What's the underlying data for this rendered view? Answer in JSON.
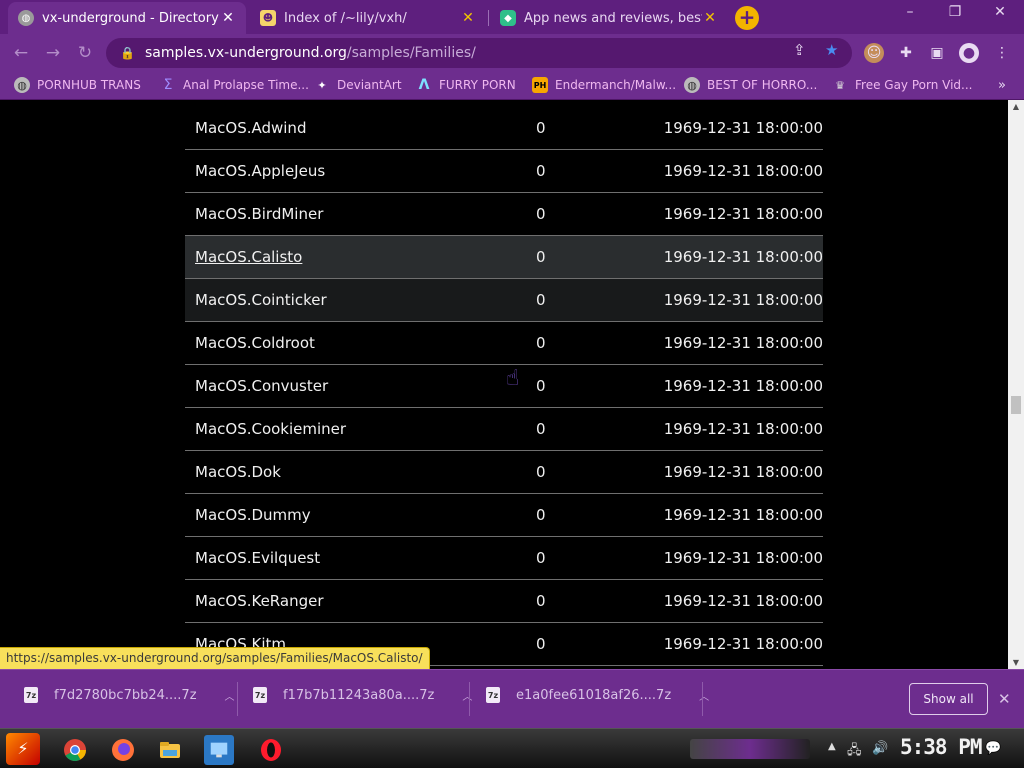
{
  "browser": {
    "tabs": [
      {
        "title": "vx-underground - Directory",
        "active": true
      },
      {
        "title": "Index of /~lily/vxh/",
        "active": false
      },
      {
        "title": "App news and reviews, best sof",
        "active": false
      }
    ],
    "url_host": "samples.vx-underground.org",
    "url_path": "/samples/Families/",
    "bookmarks": [
      {
        "label": "PORNHUB TRANS"
      },
      {
        "label": "Anal Prolapse Time..."
      },
      {
        "label": "DeviantArt"
      },
      {
        "label": "FURRY PORN"
      },
      {
        "label": "Endermanch/Malw..."
      },
      {
        "label": "BEST OF HORRO..."
      },
      {
        "label": "Free Gay Porn Vid..."
      }
    ],
    "bookmarks_more": "»",
    "accent_color": "#6d2d8e",
    "tab_strip_color": "#5e1f7e"
  },
  "listing": {
    "rows": [
      {
        "name": "MacOS.Adwind",
        "size": "0",
        "date": "1969-12-31 18:00:00"
      },
      {
        "name": "MacOS.AppleJeus",
        "size": "0",
        "date": "1969-12-31 18:00:00"
      },
      {
        "name": "MacOS.BirdMiner",
        "size": "0",
        "date": "1969-12-31 18:00:00"
      },
      {
        "name": "MacOS.Calisto",
        "size": "0",
        "date": "1969-12-31 18:00:00"
      },
      {
        "name": "MacOS.Cointicker",
        "size": "0",
        "date": "1969-12-31 18:00:00"
      },
      {
        "name": "MacOS.Coldroot",
        "size": "0",
        "date": "1969-12-31 18:00:00"
      },
      {
        "name": "MacOS.Convuster",
        "size": "0",
        "date": "1969-12-31 18:00:00"
      },
      {
        "name": "MacOS.Cookieminer",
        "size": "0",
        "date": "1969-12-31 18:00:00"
      },
      {
        "name": "MacOS.Dok",
        "size": "0",
        "date": "1969-12-31 18:00:00"
      },
      {
        "name": "MacOS.Dummy",
        "size": "0",
        "date": "1969-12-31 18:00:00"
      },
      {
        "name": "MacOS.Evilquest",
        "size": "0",
        "date": "1969-12-31 18:00:00"
      },
      {
        "name": "MacOS.KeRanger",
        "size": "0",
        "date": "1969-12-31 18:00:00"
      },
      {
        "name": "MacOS.Kitm",
        "size": "0",
        "date": "1969-12-31 18:00:00"
      }
    ]
  },
  "status_bar_url": "https://samples.vx-underground.org/samples/Families/MacOS.Calisto/",
  "downloads": {
    "items": [
      {
        "filename": "f7d2780bc7bb24....7z"
      },
      {
        "filename": "f17b7b11243a80a....7z"
      },
      {
        "filename": "e1a0fee61018af26....7z"
      }
    ],
    "show_all_label": "Show all"
  },
  "taskbar": {
    "clock": "5:38 PM"
  }
}
